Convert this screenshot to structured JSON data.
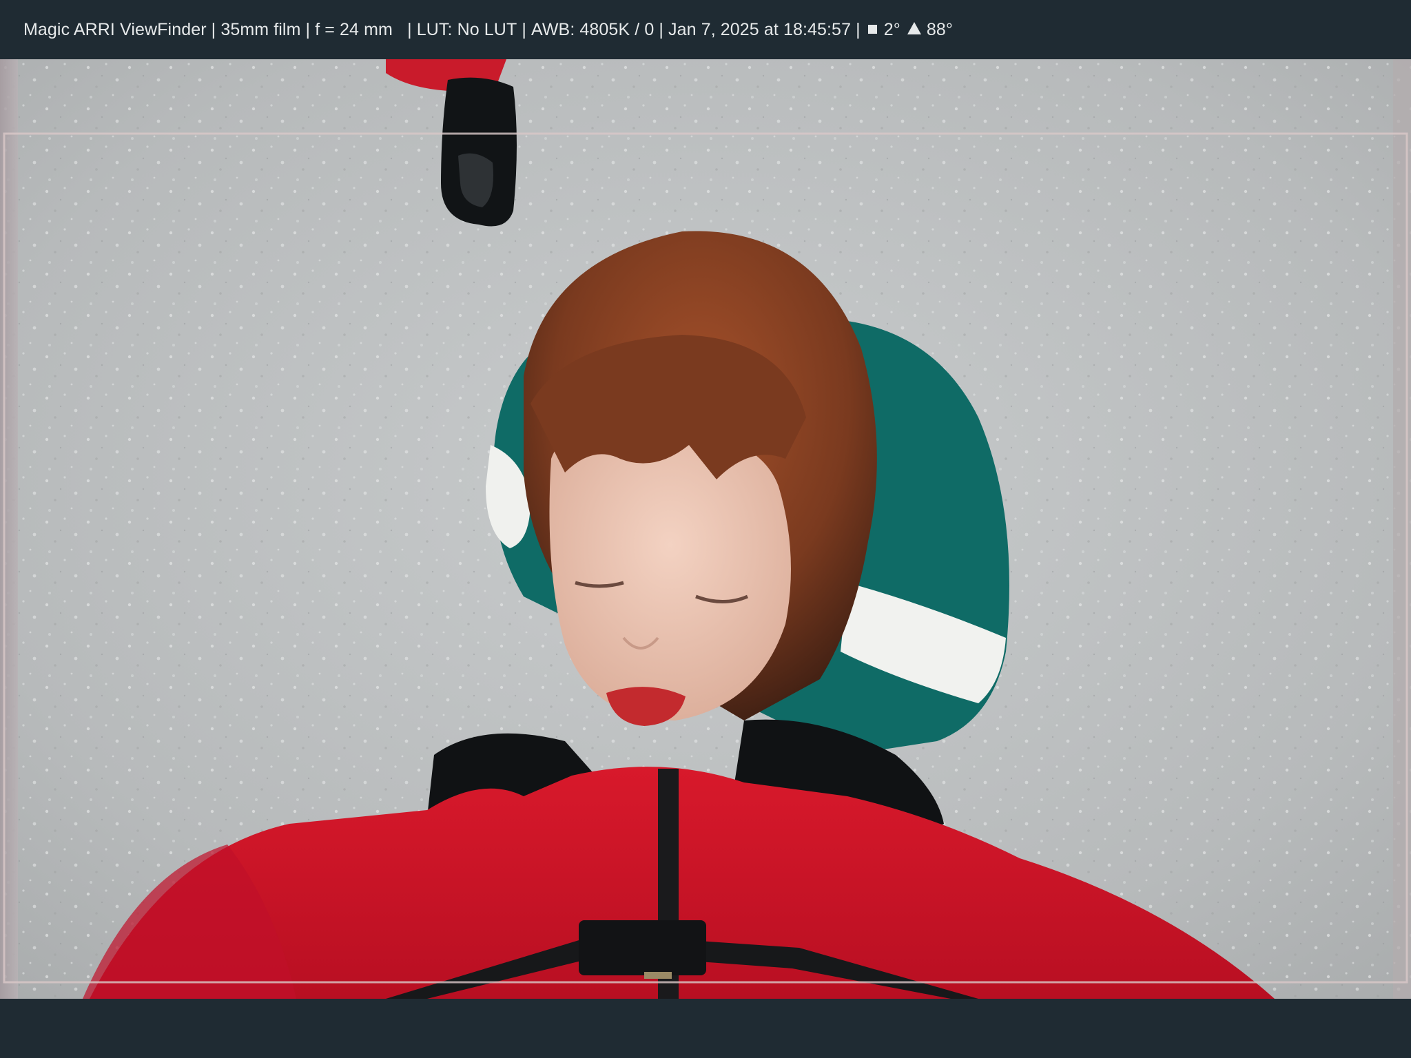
{
  "header": {
    "app_name": "Magic ARRI ViewFinder",
    "format": "35mm film",
    "focal_length": "f = 24 mm",
    "lut": "LUT: No LUT",
    "awb": "AWB: 4805K / 0",
    "timestamp": "Jan 7, 2025 at 18:45:57",
    "roll": "2°",
    "tilt": "88°",
    "separator": " | ",
    "roll_icon": "square-icon",
    "tilt_icon": "triangle-icon"
  },
  "colors": {
    "chrome": "#1f2b33",
    "text": "#e6e9ea",
    "frame_guide": "#d9c8c8"
  }
}
